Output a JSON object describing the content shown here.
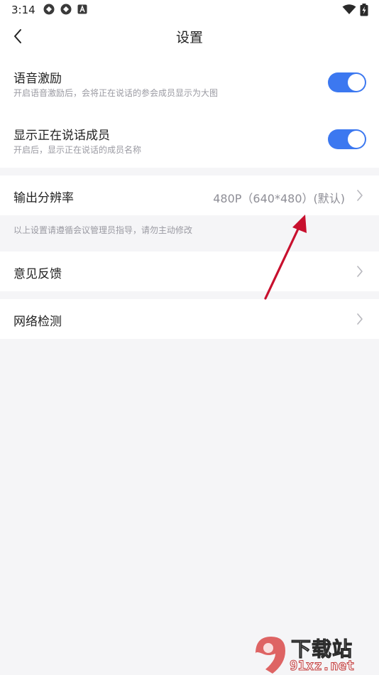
{
  "status_bar": {
    "time": "3:14",
    "icons": [
      "sync-icon",
      "sync-icon",
      "app-a-icon",
      "wifi-icon",
      "battery-icon"
    ]
  },
  "header": {
    "title": "设置",
    "back_icon": "chevron-left-icon"
  },
  "settings": {
    "voice_motivation": {
      "title": "语音激励",
      "desc": "开启语音激励后，会将正在说话的参会成员显示为大图",
      "enabled": true
    },
    "show_speaking": {
      "title": "显示正在说话成员",
      "desc": "开启后，显示正在说话的成员名称",
      "enabled": true
    }
  },
  "resolution": {
    "label": "输出分辨率",
    "value": "480P（640*480）(默认)"
  },
  "notice": "以上设置请遵循会议管理员指导，请勿主动修改",
  "feedback": {
    "label": "意见反馈"
  },
  "network": {
    "label": "网络检测"
  },
  "watermark": {
    "top_text": "下载站",
    "bottom_text": "91xz.net"
  },
  "colors": {
    "accent": "#3c78f0",
    "background": "#f5f5f7",
    "annotation_arrow": "#c8102e"
  }
}
